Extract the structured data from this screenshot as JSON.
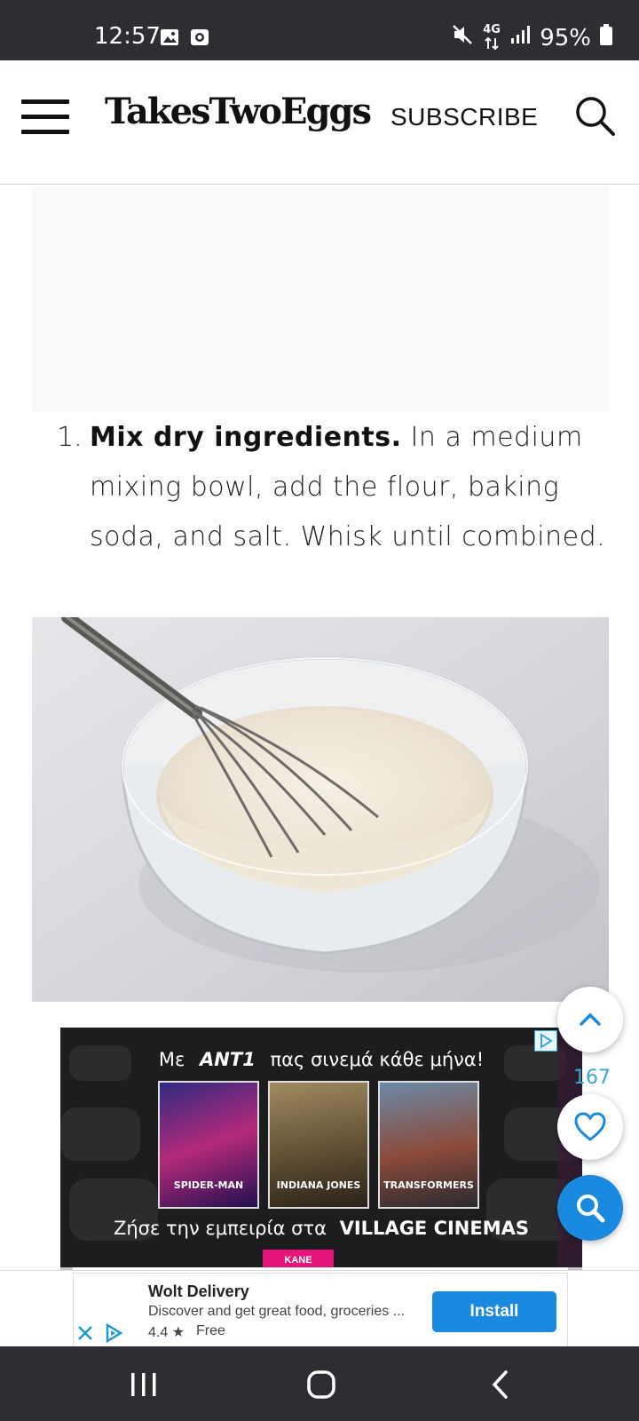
{
  "status_bar": {
    "time": "12:57",
    "network": "4G",
    "battery": "95%",
    "left_icons": [
      "image-icon",
      "screen-record-icon"
    ],
    "right_icons": [
      "mute-icon",
      "data-arrows-icon",
      "signal-icon",
      "battery-icon"
    ]
  },
  "header": {
    "menu_icon": "hamburger-menu-icon",
    "logo": "TakesTwoEggs",
    "subscribe": "SUBSCRIBE",
    "search_icon": "search-icon"
  },
  "instructions": {
    "step_number": "1.",
    "step_title": "Mix dry ingredients.",
    "step_text": " In a medium mixing bowl, add the flour, baking soda, and salt. Whisk until combined."
  },
  "ad_banner": {
    "line1_before": "Με",
    "brand": "ANT1",
    "line1_after": "πας σινεμά κάθε μήνα!",
    "posters": [
      "SPIDER-MAN",
      "INDIANA JONES",
      "TRANSFORMERS"
    ],
    "line2": "Ζήσε την εμπειρία στα",
    "cinema": "VILLAGE CINEMAS",
    "cta": "ΚΑΝΕ"
  },
  "floating": {
    "favorites_count": "167",
    "icons": [
      "chevron-up-icon",
      "heart-icon",
      "search-icon"
    ]
  },
  "bottom_ad": {
    "title": "Wolt Delivery",
    "description": "Discover and get great food, groceries ...",
    "rating": "4.4 ★",
    "price": "Free",
    "install": "Install"
  },
  "colors": {
    "accent_blue": "#1a8ae0",
    "status_bar": "#2d2e33",
    "ad_pink": "#e6157a"
  }
}
